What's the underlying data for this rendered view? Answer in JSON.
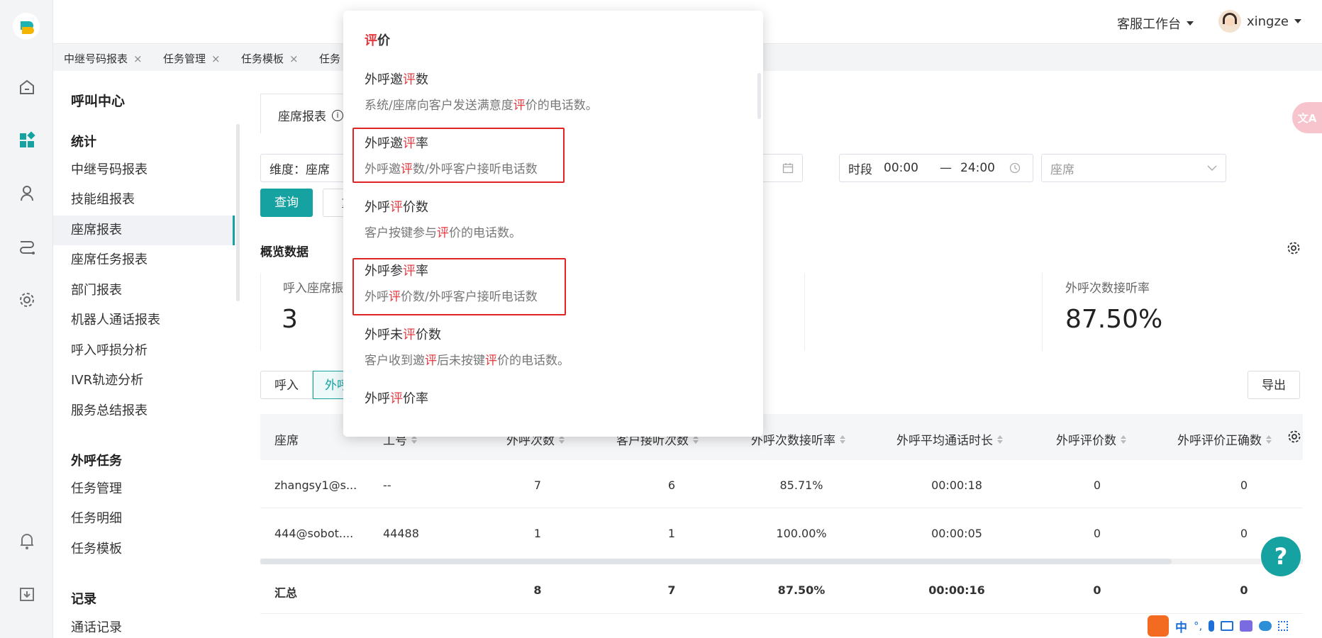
{
  "topbar": {
    "workbench": "客服工作台",
    "username": "xingze"
  },
  "tabs": [
    {
      "label": "中继号码报表",
      "close": "×"
    },
    {
      "label": "任务管理",
      "close": "×"
    },
    {
      "label": "任务模板",
      "close": "×"
    },
    {
      "label": "任务",
      "close": ""
    }
  ],
  "sidebar": {
    "title": "呼叫中心",
    "groups": [
      {
        "label": "统计"
      },
      {
        "label": "外呼任务"
      },
      {
        "label": "记录"
      }
    ],
    "items": [
      "中继号码报表",
      "技能组报表",
      "座席报表",
      "座席任务报表",
      "部门报表",
      "机器人通话报表",
      "呼入呼损分析",
      "IVR轨迹分析",
      "服务总结报表",
      "任务管理",
      "任务明细",
      "任务模板",
      "通话记录"
    ]
  },
  "main": {
    "report_tab": "座席报表",
    "info_glyph": "i",
    "dimension": "维度：座席",
    "query": "查询",
    "reset": "重",
    "period_label": "时段",
    "time_start": "00:00",
    "dash": "—",
    "time_end": "24:00",
    "agent_placeholder": "座席",
    "overview_title": "概览数据",
    "kpi_left_label": "呼入座席振",
    "kpi_left_value": "3",
    "kpi_right_label": "外呼次数接听率",
    "kpi_right_value": "87.50%",
    "toggle_in": "呼入",
    "toggle_out": "外呼",
    "export": "导出"
  },
  "table": {
    "headers": [
      "座席",
      "工号",
      "外呼次数",
      "客户接听次数",
      "外呼次数接听率",
      "外呼平均通话时长",
      "外呼评价数",
      "外呼评价正确数"
    ],
    "rows": [
      [
        "zhangsy1@s...",
        "--",
        "7",
        "6",
        "85.71%",
        "00:00:18",
        "0",
        "0"
      ],
      [
        "444@sobot....",
        "44488",
        "1",
        "1",
        "100.00%",
        "00:00:05",
        "0",
        "0"
      ]
    ],
    "summary": [
      "汇总",
      "",
      "8",
      "7",
      "87.50%",
      "00:00:16",
      "0",
      "0"
    ]
  },
  "popup": {
    "heading_hl": "评",
    "heading_rest": "价",
    "entries": [
      {
        "t1": "外呼邀",
        "t2": "评",
        "t3": "数",
        "desc": [
          [
            "系统/座席向客户发送满意度",
            ""
          ],
          [
            "评",
            "hl"
          ],
          [
            "价的电话数。",
            ""
          ]
        ]
      },
      {
        "t1": "外呼邀",
        "t2": "评",
        "t3": "率",
        "desc": [
          [
            "外呼邀",
            ""
          ],
          [
            "评",
            "hl"
          ],
          [
            "数/外呼客户接听电话数",
            ""
          ]
        ]
      },
      {
        "t1": "外呼",
        "t2": "评",
        "t3": "价数",
        "desc": [
          [
            "客户按键参与",
            ""
          ],
          [
            "评",
            "hl"
          ],
          [
            "价的电话数。",
            ""
          ]
        ]
      },
      {
        "t1": "外呼参",
        "t2": "评",
        "t3": "率",
        "desc": [
          [
            "外呼",
            ""
          ],
          [
            "评",
            "hl"
          ],
          [
            "价数/外呼客户接听电话数",
            ""
          ]
        ]
      },
      {
        "t1": "外呼未",
        "t2": "评",
        "t3": "价数",
        "desc": [
          [
            "客户收到邀",
            ""
          ],
          [
            "评",
            "hl"
          ],
          [
            "后未按键",
            ""
          ],
          [
            "评",
            "hl"
          ],
          [
            "价的电话数。",
            ""
          ]
        ]
      },
      {
        "t1": "外呼",
        "t2": "评",
        "t3": "价率",
        "desc": []
      }
    ]
  },
  "tray": {
    "ime": "中",
    "punct": "°,"
  },
  "misc": {
    "help": "?",
    "translate": "文A"
  }
}
